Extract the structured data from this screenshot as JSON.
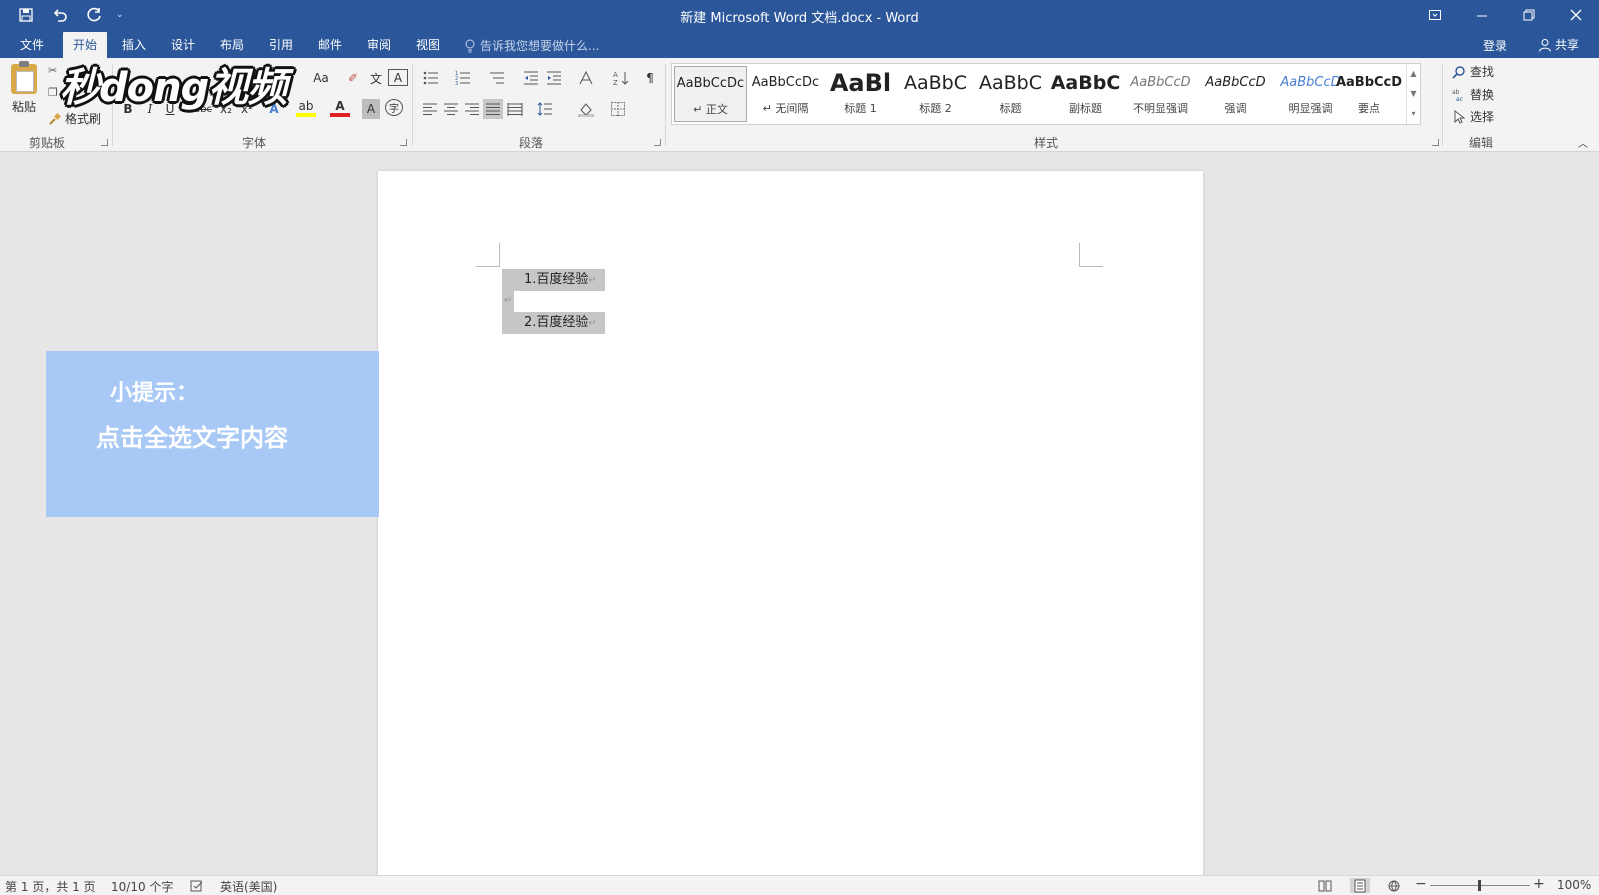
{
  "window": {
    "title": "新建 Microsoft Word 文档.docx - Word",
    "quick_access": {
      "save_icon": "save-icon",
      "undo_icon": "undo-icon",
      "redo_icon": "redo-icon",
      "customize_label": "⌄"
    }
  },
  "tabs": [
    {
      "label": "文件"
    },
    {
      "label": "开始",
      "active": true
    },
    {
      "label": "插入"
    },
    {
      "label": "设计"
    },
    {
      "label": "布局"
    },
    {
      "label": "引用"
    },
    {
      "label": "邮件"
    },
    {
      "label": "审阅"
    },
    {
      "label": "视图"
    }
  ],
  "tell_me": {
    "placeholder": "告诉我您想要做什么..."
  },
  "account": {
    "signin": "登录",
    "share": "共享"
  },
  "ribbon": {
    "clipboard": {
      "paste": "粘贴",
      "format_painter": "格式刷",
      "label": "剪贴板"
    },
    "font": {
      "label": "字体",
      "change_case": "Aa",
      "bold": "B",
      "italic": "I",
      "underline": "U",
      "strike": "abc",
      "subscript": "x₂",
      "superscript": "x²",
      "text_effects": "A",
      "font_color": "A",
      "char_shading": "A",
      "enclosed": "字"
    },
    "paragraph": {
      "label": "段落"
    },
    "styles": {
      "label": "样式",
      "items": [
        {
          "sample": "AaBbCcDc",
          "name": "↵ 正文"
        },
        {
          "sample": "AaBbCcDc",
          "name": "↵ 无间隔"
        },
        {
          "sample": "AaBl",
          "name": "标题 1"
        },
        {
          "sample": "AaBbC",
          "name": "标题 2"
        },
        {
          "sample": "AaBbC",
          "name": "标题"
        },
        {
          "sample": "AaBbC",
          "name": "副标题"
        },
        {
          "sample": "AaBbCcD",
          "name": "不明显强调"
        },
        {
          "sample": "AaBbCcD",
          "name": "强调"
        },
        {
          "sample": "AaBbCcD",
          "name": "明显强调"
        },
        {
          "sample": "AaBbCcD",
          "name": "要点"
        }
      ]
    },
    "editing": {
      "label": "编辑",
      "find": "查找",
      "replace": "替换",
      "select": "选择"
    }
  },
  "logo": {
    "text": "秒dong视频"
  },
  "document": {
    "lines": [
      "1.百度经验",
      "2.百度经验"
    ],
    "para_mark": "↵"
  },
  "tip": {
    "title": "小提示：",
    "body": "点击全选文字内容"
  },
  "status": {
    "page": "第 1 页，共 1 页",
    "words": "10/10 个字",
    "language": "英语(美国)",
    "zoom": "100%",
    "zoom_minus": "−",
    "zoom_plus": "+"
  },
  "colors": {
    "title_bar": "#2b579a",
    "tip_bg": "#a8c8f5",
    "selection": "#c6c6c6"
  }
}
